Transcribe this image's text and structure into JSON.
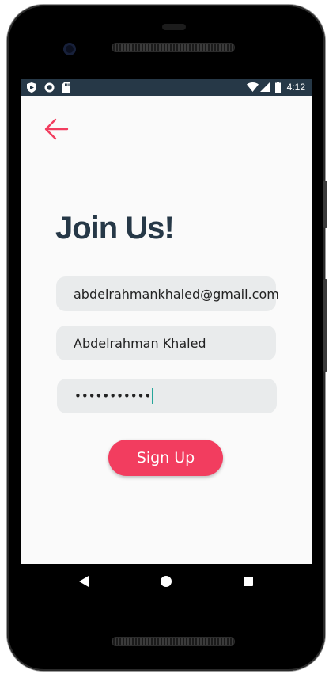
{
  "status_bar": {
    "time": "4:12",
    "left_icons": [
      "play-protect-icon",
      "sync-circle-icon",
      "sd-card-icon"
    ],
    "right_icons": [
      "wifi-icon",
      "signal-icon",
      "battery-icon"
    ]
  },
  "toolbar": {
    "back_icon": "arrow-left-icon"
  },
  "page": {
    "title": "Join Us!"
  },
  "form": {
    "email_value": "abdelrahmankhaled@gmail.com",
    "name_value": "Abdelrahman Khaled",
    "password_masked": "•••••••••••",
    "signup_label": "Sign Up"
  },
  "nav_bar": {
    "icons": [
      "nav-back-icon",
      "nav-home-icon",
      "nav-recents-icon"
    ]
  },
  "colors": {
    "accent": "#f23d5f",
    "title": "#263847",
    "status_bar": "#263847",
    "field_bg": "#e9ebec",
    "caret": "#26a69a"
  }
}
